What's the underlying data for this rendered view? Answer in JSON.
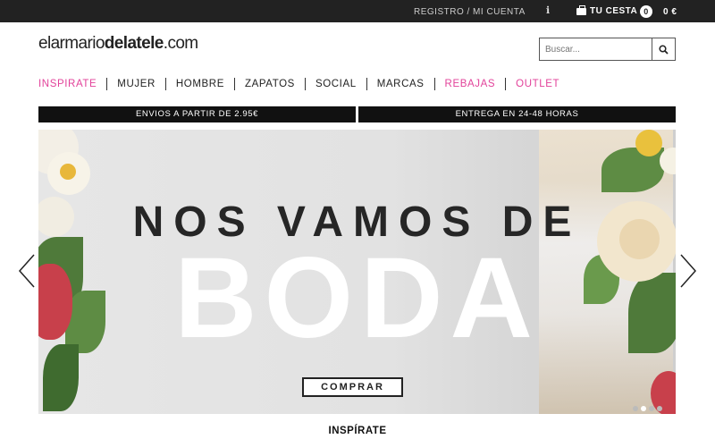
{
  "topbar": {
    "register": "REGISTRO / MI CUENTA",
    "info_icon": "info-icon",
    "cart_label": "TU CESTA",
    "cart_count": "0",
    "cart_total": "0 €"
  },
  "logo": {
    "part1": "elarmario",
    "part2": "delatele",
    "part3": ".com"
  },
  "search": {
    "placeholder": "Buscar..."
  },
  "nav": {
    "items": [
      {
        "label": "INSPIRATE",
        "color": "#e2429a"
      },
      {
        "label": "MUJER"
      },
      {
        "label": "HOMBRE"
      },
      {
        "label": "ZAPATOS"
      },
      {
        "label": "SOCIAL"
      },
      {
        "label": "MARCAS"
      },
      {
        "label": "REBAJAS",
        "color": "#e2429a"
      },
      {
        "label": "OUTLET",
        "color": "#e2429a"
      }
    ]
  },
  "promo": {
    "shipping": "ENVIOS A PARTIR DE 2.95€",
    "delivery": "ENTREGA EN 24-48 HORAS"
  },
  "hero": {
    "line1": "NOS VAMOS DE",
    "line2": "BODA",
    "cta": "COMPRAR"
  },
  "section": {
    "title": "INSPÍRATE"
  },
  "colors": {
    "accent": "#e2429a",
    "dark": "#222222"
  }
}
